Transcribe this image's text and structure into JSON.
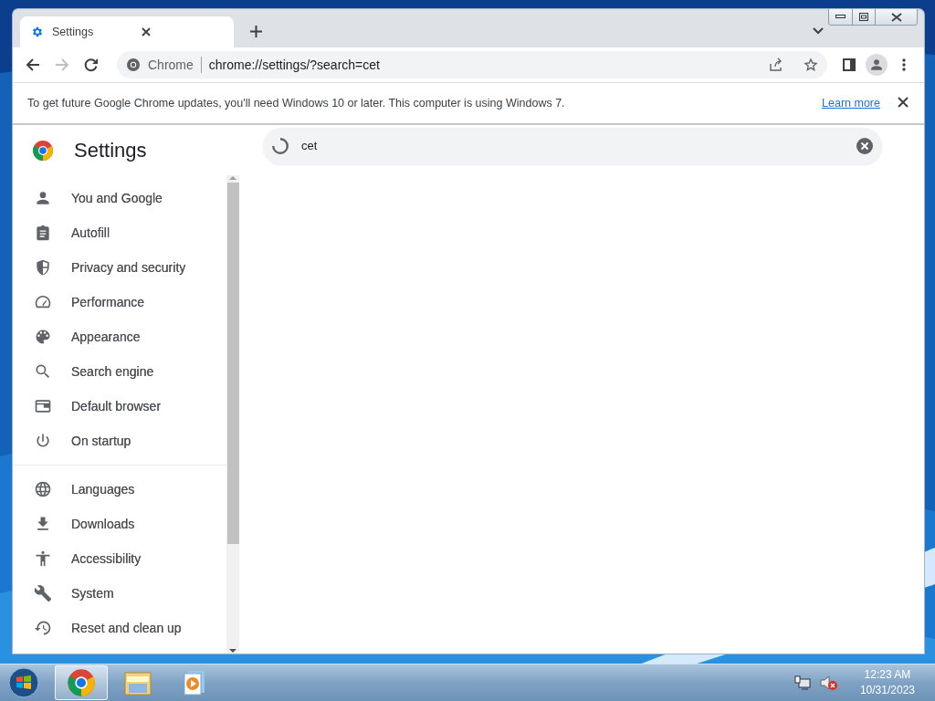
{
  "tabs": [
    {
      "label": "Settings",
      "selected": true
    }
  ],
  "toolbar": {
    "site_label": "Chrome",
    "url": "chrome://settings/?search=cet"
  },
  "infobar": {
    "message": "To get future Google Chrome updates, you'll need Windows 10 or later. This computer is using Windows 7.",
    "link": "Learn more"
  },
  "settings": {
    "title": "Settings",
    "search": {
      "value": "cet",
      "loading": true
    },
    "sections": [
      [
        {
          "label": "You and Google",
          "kind": "person",
          "selected": false
        },
        {
          "label": "Autofill",
          "kind": "clipboard",
          "selected": false
        },
        {
          "label": "Privacy and security",
          "kind": "shield",
          "selected": false
        },
        {
          "label": "Performance",
          "kind": "gauge",
          "selected": false
        },
        {
          "label": "Appearance",
          "kind": "palette",
          "selected": false
        },
        {
          "label": "Search engine",
          "kind": "search",
          "selected": false
        },
        {
          "label": "Default browser",
          "kind": "browser",
          "selected": false
        },
        {
          "label": "On startup",
          "kind": "power",
          "selected": false
        }
      ],
      [
        {
          "label": "Languages",
          "kind": "globe",
          "selected": false
        },
        {
          "label": "Downloads",
          "kind": "download",
          "selected": false
        },
        {
          "label": "Accessibility",
          "kind": "accessibility",
          "selected": false
        },
        {
          "label": "System",
          "kind": "wrench",
          "selected": false
        },
        {
          "label": "Reset and clean up",
          "kind": "history",
          "selected": false
        }
      ]
    ]
  },
  "taskbar": {
    "apps": [
      {
        "kind": "chrome",
        "selected": true
      },
      {
        "kind": "folder",
        "selected": false
      },
      {
        "kind": "media",
        "selected": false
      }
    ],
    "time": "12:23 AM",
    "date": "10/31/2023"
  }
}
